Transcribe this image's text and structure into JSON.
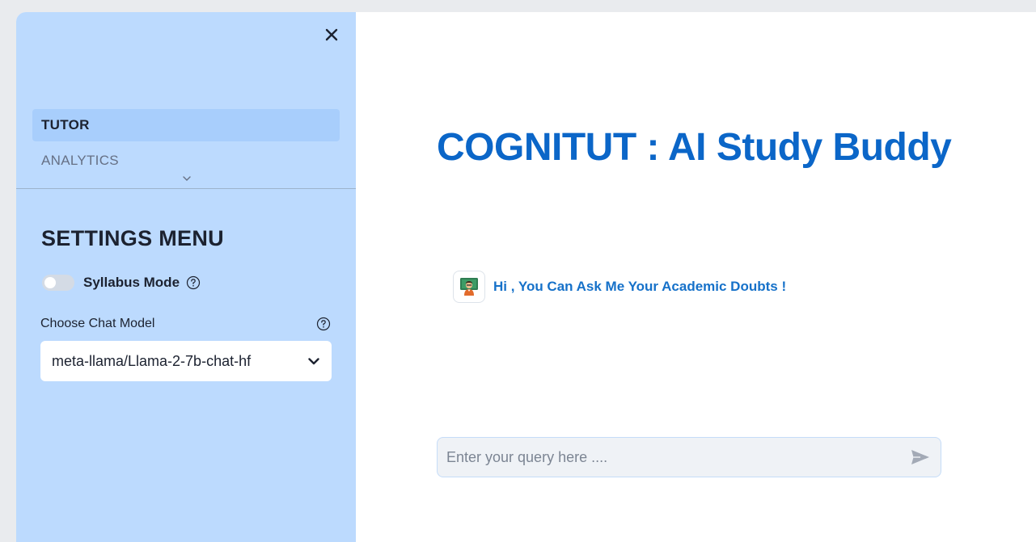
{
  "sidebar": {
    "close_icon": "close-icon",
    "nav": {
      "items": [
        {
          "label": "TUTOR",
          "active": true
        },
        {
          "label": "ANALYTICS",
          "active": false
        }
      ],
      "expand_icon": "chevron-down-icon"
    },
    "settings": {
      "title": "SETTINGS MENU",
      "syllabus_toggle": {
        "label": "Syllabus Mode",
        "enabled": false
      },
      "chat_model": {
        "label": "Choose Chat Model",
        "selected": "meta-llama/Llama-2-7b-chat-hf"
      }
    }
  },
  "main": {
    "title": "COGNITUT : AI Study Buddy",
    "messages": [
      {
        "avatar_icon": "teacher-avatar-icon",
        "text": "Hi , You Can Ask Me Your Academic Doubts !"
      }
    ],
    "query": {
      "placeholder": "Enter your query here ....",
      "value": "",
      "send_icon": "send-icon"
    }
  },
  "colors": {
    "sidebar_bg": "#bcdafe",
    "nav_active_bg": "#a8cefc",
    "title": "#0b66c8",
    "message_text": "#1671c9",
    "query_bg": "#eff2f6"
  }
}
